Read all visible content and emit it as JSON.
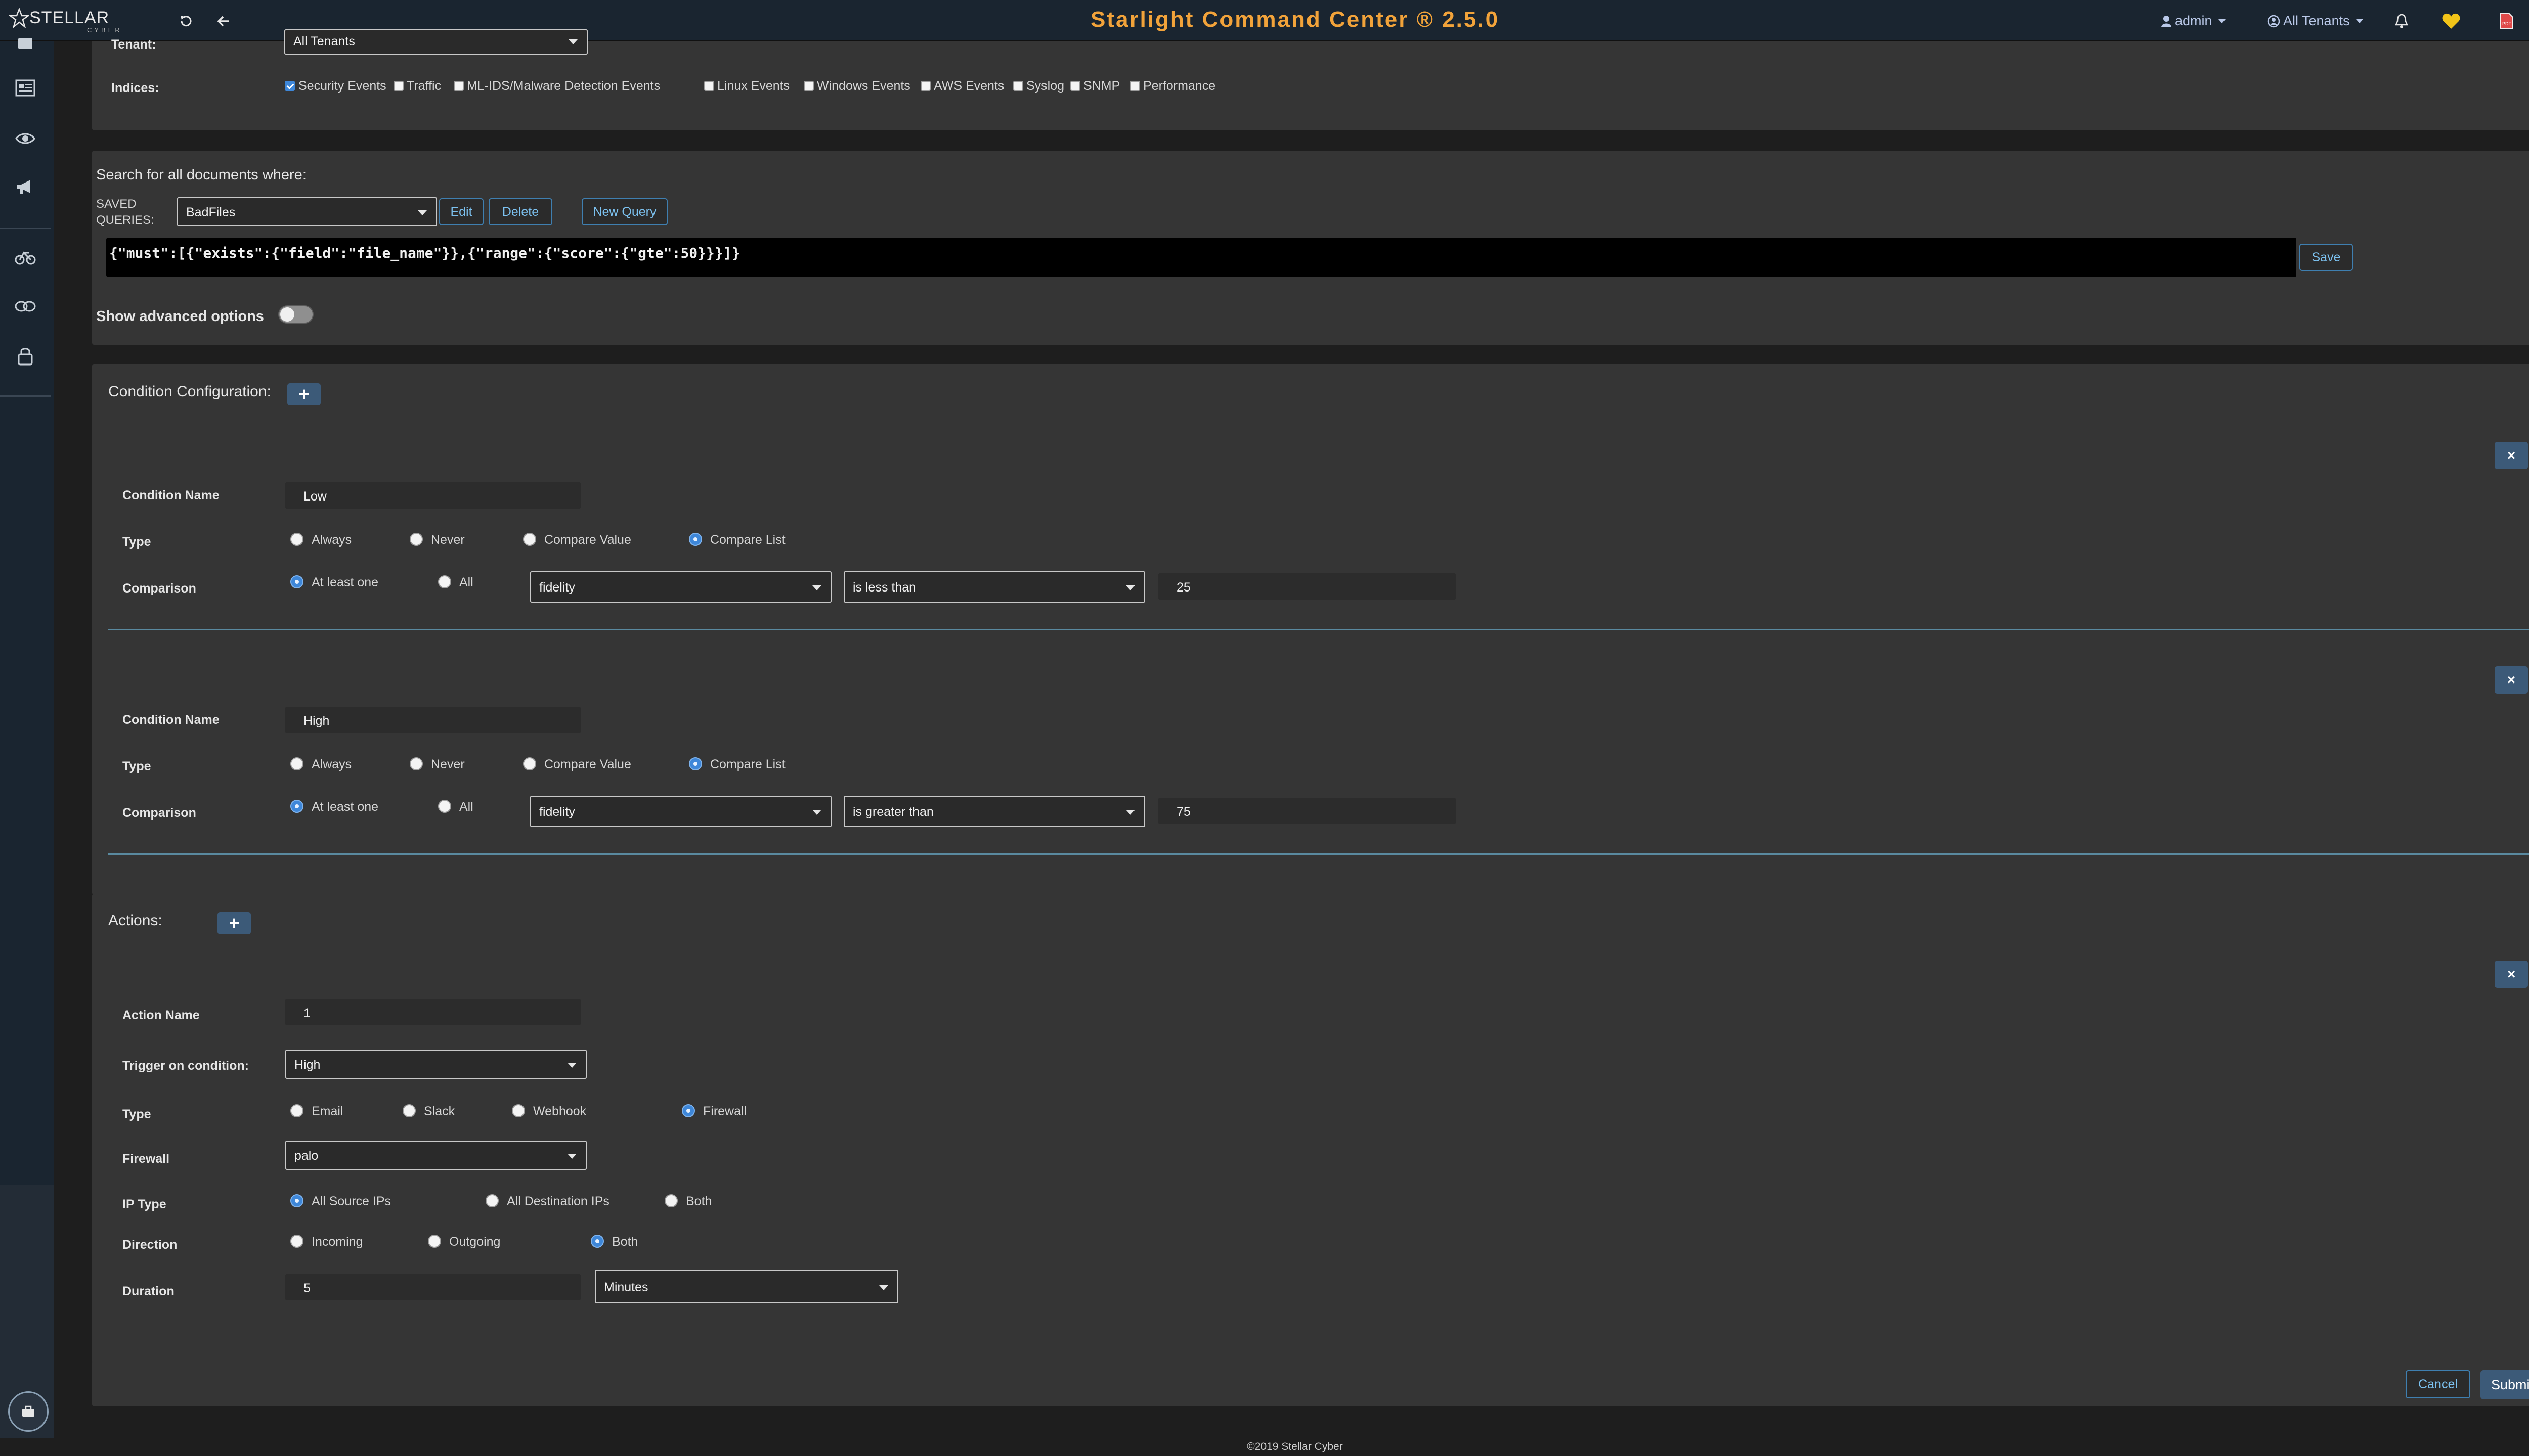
{
  "header": {
    "brand": "STELLAR",
    "brand_sub": "CYBER",
    "title": "Starlight Command Center ® 2.5.0",
    "user": "admin",
    "tenant": "All Tenants"
  },
  "filters": {
    "tenant_label": "Tenant:",
    "tenant_value": "All Tenants",
    "indices_label": "Indices:",
    "indices": [
      {
        "label": "Security Events",
        "checked": true
      },
      {
        "label": "Traffic",
        "checked": false
      },
      {
        "label": "ML-IDS/Malware Detection Events",
        "checked": false
      },
      {
        "label": "Linux Events",
        "checked": false
      },
      {
        "label": "Windows Events",
        "checked": false
      },
      {
        "label": "AWS Events",
        "checked": false
      },
      {
        "label": "Syslog",
        "checked": false
      },
      {
        "label": "SNMP",
        "checked": false
      },
      {
        "label": "Performance",
        "checked": false
      }
    ]
  },
  "search": {
    "title": "Search for all documents where:",
    "saved_queries_label_1": "SAVED",
    "saved_queries_label_2": "QUERIES:",
    "saved_query_value": "BadFiles",
    "edit_label": "Edit",
    "delete_label": "Delete",
    "new_query_label": "New Query",
    "query": "{\"must\":[{\"exists\":{\"field\":\"file_name\"}},{\"range\":{\"score\":{\"gte\":50}}}]}",
    "save_label": "Save",
    "advanced_label": "Show advanced options",
    "advanced_on": false
  },
  "conditions": {
    "title": "Condition Configuration:",
    "add_label": "+",
    "remove_label": "×",
    "name_label": "Condition Name",
    "type_label": "Type",
    "comparison_label": "Comparison",
    "type_options": [
      "Always",
      "Never",
      "Compare Value",
      "Compare List"
    ],
    "match_options": [
      "At least one",
      "All"
    ],
    "items": [
      {
        "name": "Low",
        "type": "Compare List",
        "match": "At least one",
        "field": "fidelity",
        "operator": "is less than",
        "value": "25"
      },
      {
        "name": "High",
        "type": "Compare List",
        "match": "At least one",
        "field": "fidelity",
        "operator": "is greater than",
        "value": "75"
      }
    ]
  },
  "actions": {
    "title": "Actions:",
    "add_label": "+",
    "remove_label": "×",
    "name_label": "Action Name",
    "name_value": "1",
    "trigger_label": "Trigger on condition:",
    "trigger_value": "High",
    "type_label": "Type",
    "type_options": [
      "Email",
      "Slack",
      "Webhook",
      "Firewall"
    ],
    "type_selected": "Firewall",
    "firewall_label": "Firewall",
    "firewall_value": "palo",
    "ip_type_label": "IP Type",
    "ip_type_options": [
      "All Source IPs",
      "All Destination IPs",
      "Both"
    ],
    "ip_type_selected": "All Source IPs",
    "direction_label": "Direction",
    "direction_options": [
      "Incoming",
      "Outgoing",
      "Both"
    ],
    "direction_selected": "Both",
    "duration_label": "Duration",
    "duration_value": "5",
    "duration_unit": "Minutes"
  },
  "form_buttons": {
    "cancel_label": "Cancel",
    "submit_label": "Submit"
  },
  "footer": {
    "copyright": "©2019 Stellar Cyber"
  },
  "colors": {
    "title_accent": "#f2a33a",
    "primary": "#3e87d9",
    "button_dark": "#3c5a78",
    "link_blue": "#7cc1ef"
  }
}
